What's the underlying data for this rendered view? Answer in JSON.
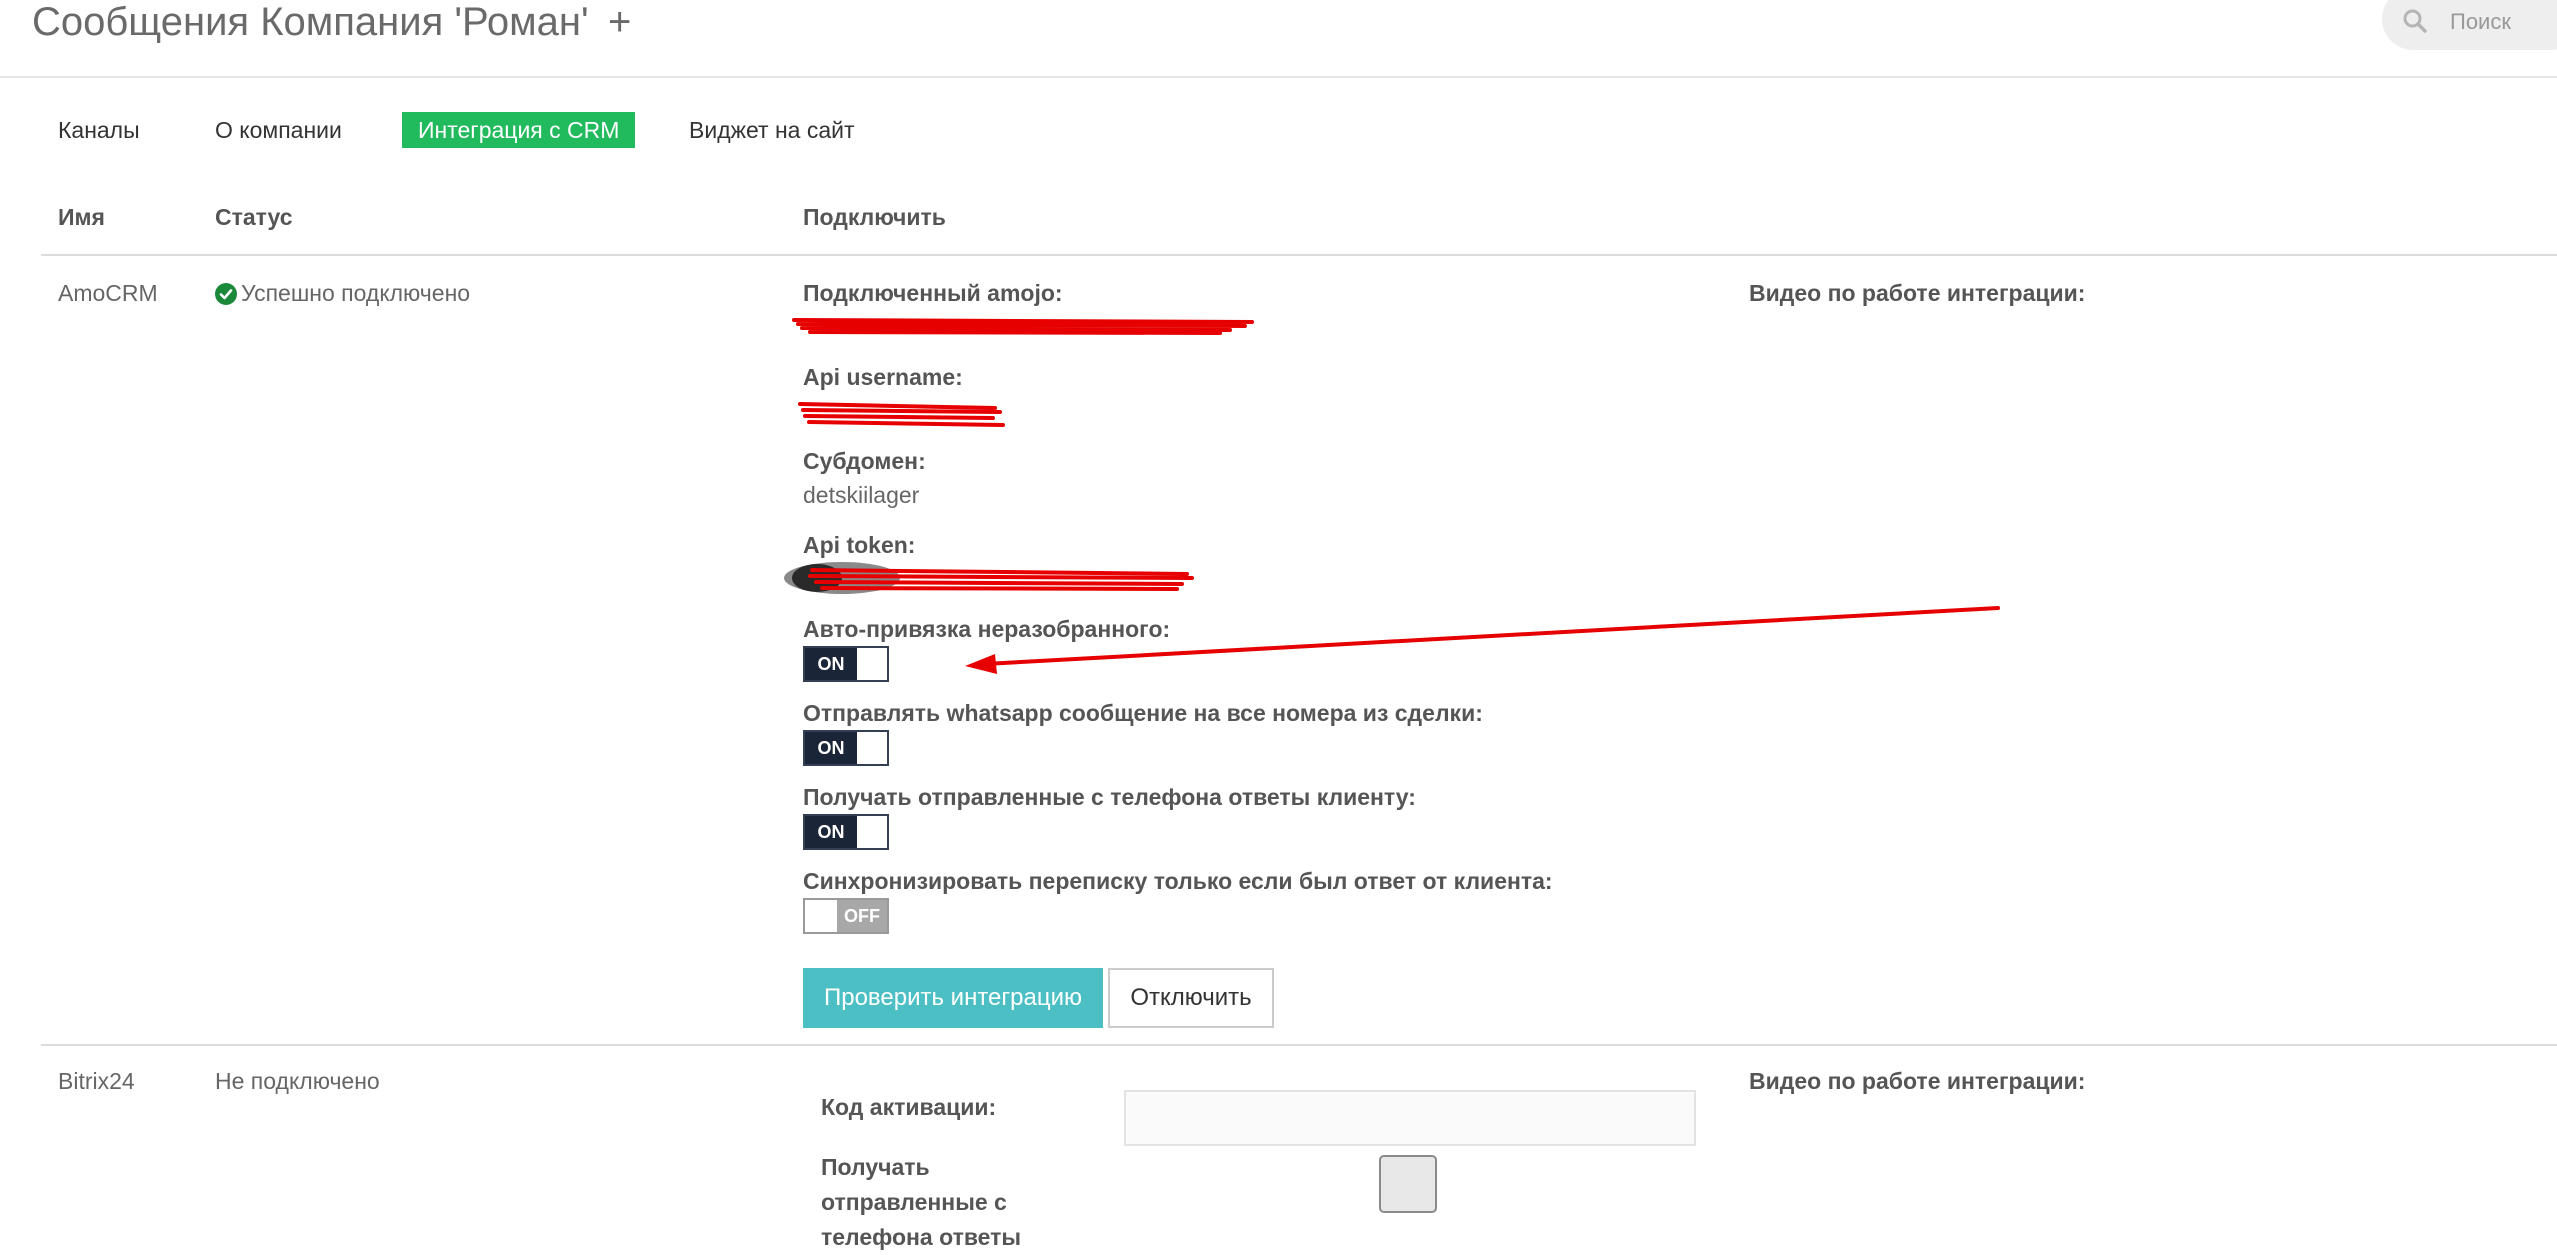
{
  "header": {
    "title": "Сообщения Компания 'Роман'",
    "add_label": "+",
    "search_placeholder": "Поиск"
  },
  "tabs": [
    {
      "label": "Каналы",
      "active": false
    },
    {
      "label": "О компании",
      "active": false
    },
    {
      "label": "Интеграция с CRM",
      "active": true
    },
    {
      "label": "Виджет на сайт",
      "active": false
    }
  ],
  "table": {
    "columns": [
      "Имя",
      "Статус",
      "Подключить"
    ]
  },
  "amocrm": {
    "name": "AmoCRM",
    "status": "Успешно подключено",
    "fields": {
      "amojo_label": "Подключенный amojo:",
      "api_username_label": "Api username:",
      "subdomain_label": "Субдомен:",
      "subdomain_value": "detskiilager",
      "api_token_label": "Api token:"
    },
    "toggles": [
      {
        "label": "Авто-привязка неразобранного:",
        "state": "ON"
      },
      {
        "label": "Отправлять whatsapp сообщение на все номера из сделки:",
        "state": "ON"
      },
      {
        "label": "Получать отправленные с телефона ответы клиенту:",
        "state": "ON"
      },
      {
        "label": "Синхронизировать переписку только если был ответ от клиента:",
        "state": "OFF"
      }
    ],
    "check_button": "Проверить интеграцию",
    "disconnect_button": "Отключить",
    "video_label": "Видео по работе интеграции:"
  },
  "bitrix": {
    "name": "Bitrix24",
    "status": "Не подключено",
    "activation_label": "Код активации:",
    "receive_label": "Получать отправленные с телефона ответы",
    "video_label": "Видео по работе интеграции:"
  },
  "colors": {
    "accent_green": "#21ba5d",
    "button_teal": "#4bbfc4",
    "toggle_dark": "#1b2538",
    "annotation_red": "#e60000"
  }
}
